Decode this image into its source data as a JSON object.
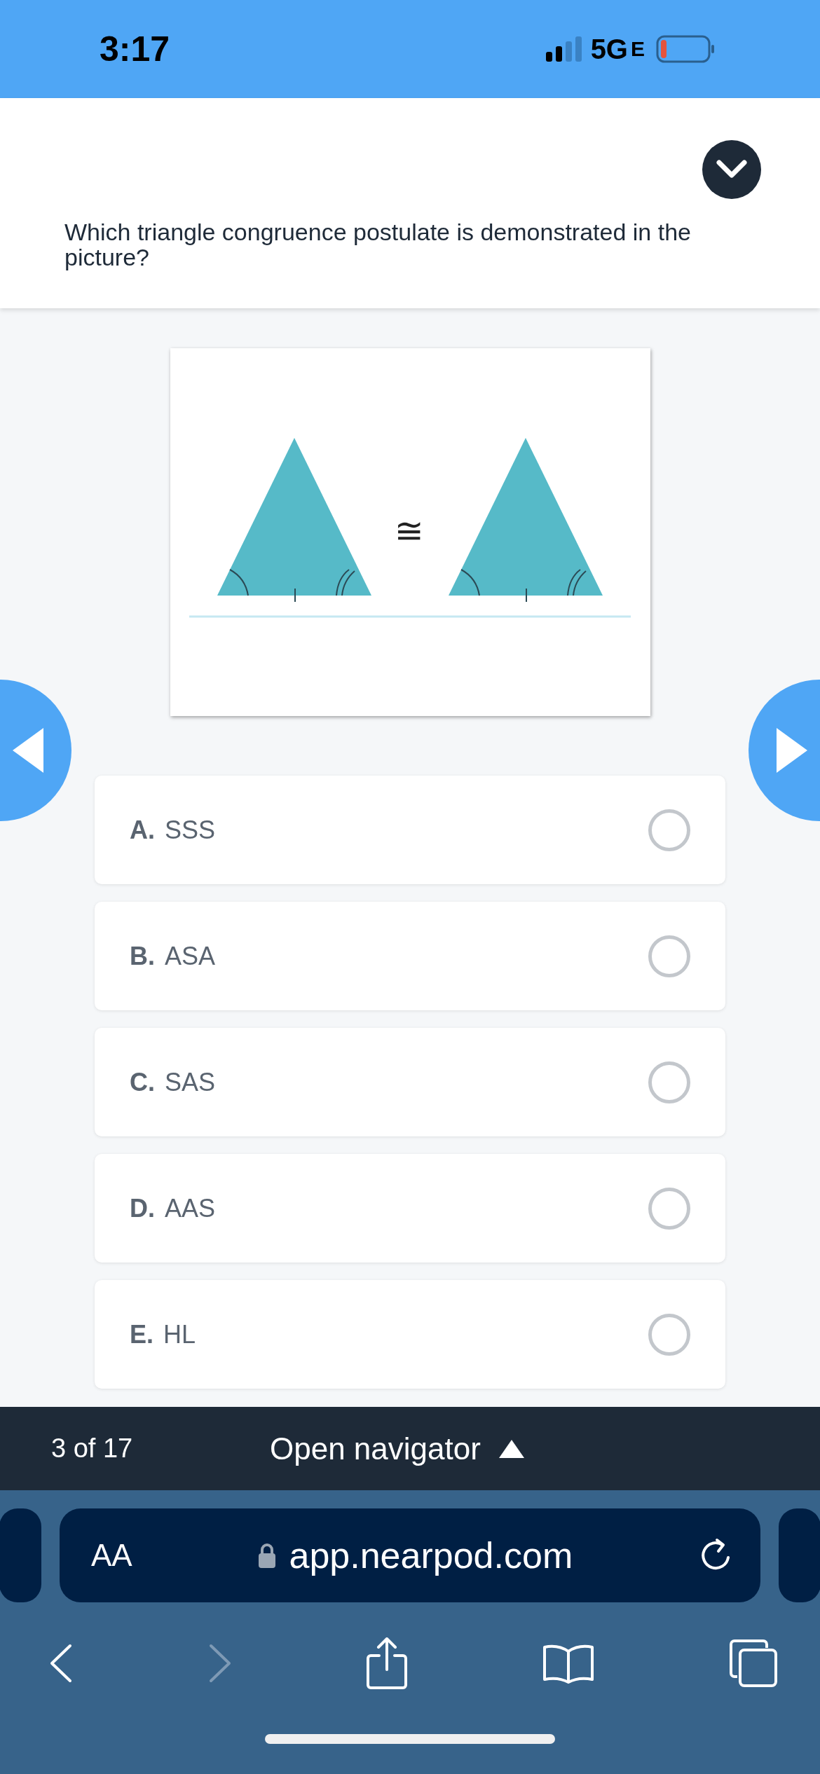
{
  "status_bar": {
    "time": "3:17",
    "network": "5G",
    "network_suffix": "E"
  },
  "question": {
    "text": "Which triangle congruence postulate is demonstrated in the picture?",
    "expanded": false
  },
  "figure": {
    "symbol": "≅"
  },
  "options": [
    {
      "letter": "A.",
      "text": "SSS",
      "selected": false
    },
    {
      "letter": "B.",
      "text": "ASA",
      "selected": false
    },
    {
      "letter": "C.",
      "text": "SAS",
      "selected": false
    },
    {
      "letter": "D.",
      "text": "AAS",
      "selected": false
    },
    {
      "letter": "E.",
      "text": "HL",
      "selected": false
    }
  ],
  "navigator": {
    "position": "3 of 17",
    "label": "Open navigator"
  },
  "browser": {
    "text_size": "AA",
    "url": "app.nearpod.com"
  }
}
